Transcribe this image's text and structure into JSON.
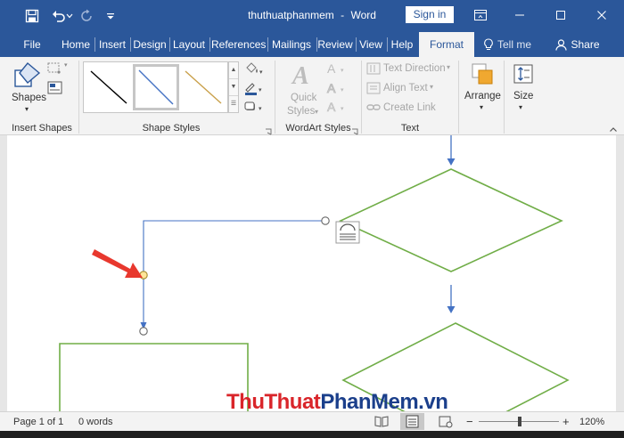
{
  "titlebar": {
    "doc_name": "thuthuatphanmem",
    "separator": "-",
    "app_name": "Word",
    "signin_label": "Sign in"
  },
  "tabs": [
    {
      "label": "File"
    },
    {
      "label": "Home"
    },
    {
      "label": "Insert"
    },
    {
      "label": "Design"
    },
    {
      "label": "Layout"
    },
    {
      "label": "References"
    },
    {
      "label": "Mailings"
    },
    {
      "label": "Review"
    },
    {
      "label": "View"
    },
    {
      "label": "Help"
    },
    {
      "label": "Format",
      "active": true
    }
  ],
  "tell_me": "Tell me",
  "share": "Share",
  "ribbon": {
    "insert_shapes": {
      "shapes_label": "Shapes",
      "group": "Insert Shapes"
    },
    "shape_styles": {
      "group": "Shape Styles"
    },
    "wordart": {
      "quick_styles_line1": "Quick",
      "quick_styles_line2": "Styles",
      "group": "WordArt Styles"
    },
    "text": {
      "text_direction": "Text Direction",
      "align_text": "Align Text",
      "create_link": "Create Link",
      "group": "Text"
    },
    "arrange": {
      "label": "Arrange"
    },
    "size": {
      "label": "Size"
    }
  },
  "colors": {
    "accent": "#2b579a",
    "shape_outline_green": "#70ad47",
    "connector_blue": "#4472c4",
    "handle_yellow": "#ffe699",
    "arrow_red": "#e8382e"
  },
  "watermark": {
    "part1": "ThuThuat",
    "part2": "PhanMem",
    "part3": ".vn"
  },
  "statusbar": {
    "page": "Page 1 of 1",
    "words": "0 words",
    "zoom_minus": "−",
    "zoom_plus": "+",
    "zoom": "120%"
  }
}
